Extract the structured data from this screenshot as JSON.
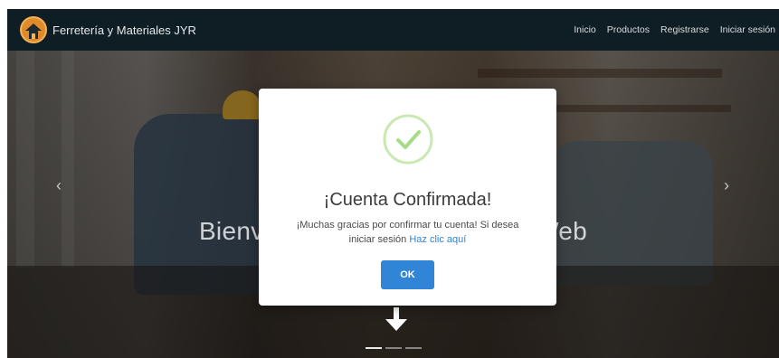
{
  "navbar": {
    "brand_name": "Ferretería y Materiales JYR",
    "links": [
      {
        "label": "Inicio"
      },
      {
        "label": "Productos"
      },
      {
        "label": "Registrarse"
      },
      {
        "label": "Iniciar sesión"
      }
    ]
  },
  "hero": {
    "title": "Bienvenido a nuestra página Web",
    "prev_icon": "chevron-left-icon",
    "next_icon": "chevron-right-icon",
    "scroll_icon": "arrow-down-icon",
    "slide_count": 3,
    "active_slide": 1
  },
  "modal": {
    "icon": "check-circle-icon",
    "title": "¡Cuenta Confirmada!",
    "message": "¡Muchas gracias por confirmar tu cuenta! Si desea iniciar sesión",
    "link_text": "Haz clic aquí",
    "ok_label": "OK"
  },
  "colors": {
    "navbar_bg": "#0f1d24",
    "accent_blue": "#3085d6",
    "success_green": "#a5dc86",
    "logo_orange": "#e08a2a"
  }
}
